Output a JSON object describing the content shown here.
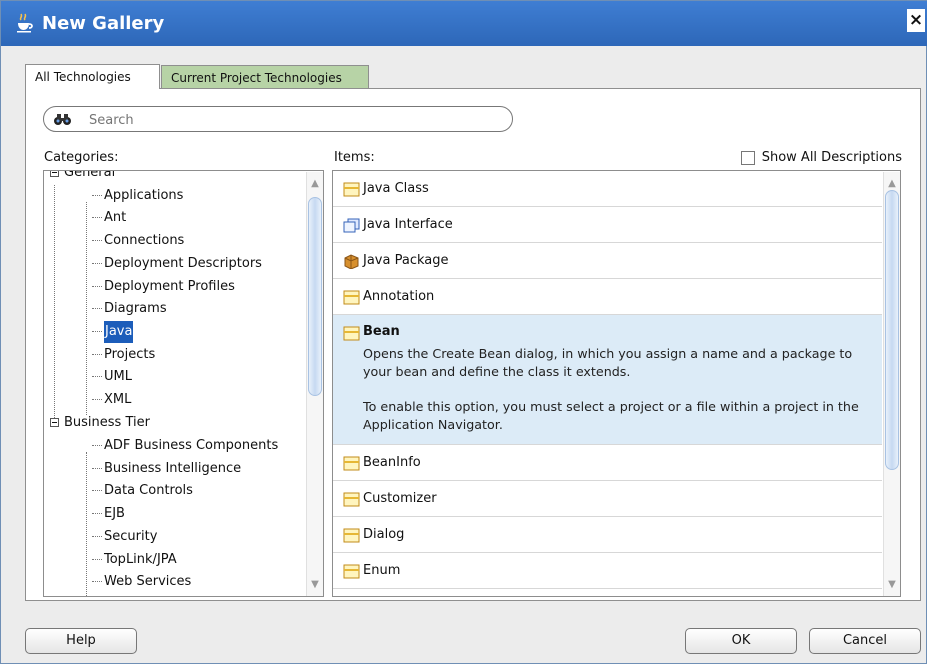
{
  "window": {
    "title": "New Gallery",
    "close_label": "×",
    "icon": "coffee-cup-icon"
  },
  "tabs": [
    {
      "label": "All Technologies",
      "active": true
    },
    {
      "label": "Current Project Technologies",
      "active": false
    }
  ],
  "search": {
    "placeholder": "Search",
    "icon": "binoculars-icon"
  },
  "labels": {
    "categories": "Categories:",
    "items": "Items:",
    "show_all_descriptions": "Show All Descriptions"
  },
  "categories": [
    {
      "label": "General",
      "expanded": true,
      "children": [
        "Applications",
        "Ant",
        "Connections",
        "Deployment Descriptors",
        "Deployment Profiles",
        "Diagrams",
        "Java",
        "Projects",
        "UML",
        "XML"
      ]
    },
    {
      "label": "Business Tier",
      "expanded": true,
      "children": [
        "ADF Business Components",
        "Business Intelligence",
        "Data Controls",
        "EJB",
        "Security",
        "TopLink/JPA",
        "Web Services"
      ]
    }
  ],
  "selected_category": "Java",
  "items": [
    {
      "label": "Java Class",
      "icon": "java-class-icon"
    },
    {
      "label": "Java Interface",
      "icon": "java-interface-icon"
    },
    {
      "label": "Java Package",
      "icon": "java-package-icon"
    },
    {
      "label": "Annotation",
      "icon": "annotation-icon"
    },
    {
      "label": "Bean",
      "icon": "bean-icon",
      "selected": true,
      "description": [
        "Opens the Create Bean dialog, in which you assign a name and a package to your bean and define the class it extends.",
        "To enable this option, you must select a project or a file within a project in the Application Navigator."
      ]
    },
    {
      "label": "BeanInfo",
      "icon": "beaninfo-icon"
    },
    {
      "label": "Customizer",
      "icon": "customizer-icon"
    },
    {
      "label": "Dialog",
      "icon": "dialog-icon"
    },
    {
      "label": "Enum",
      "icon": "enum-icon"
    }
  ],
  "buttons": {
    "help": "Help",
    "ok": "OK",
    "cancel": "Cancel"
  },
  "colors": {
    "title_bar": "#2d67b8",
    "selected_tree_item": "#1c5dba",
    "selected_list_item": "#dcebf7",
    "inactive_tab": "#b7d3a6"
  }
}
